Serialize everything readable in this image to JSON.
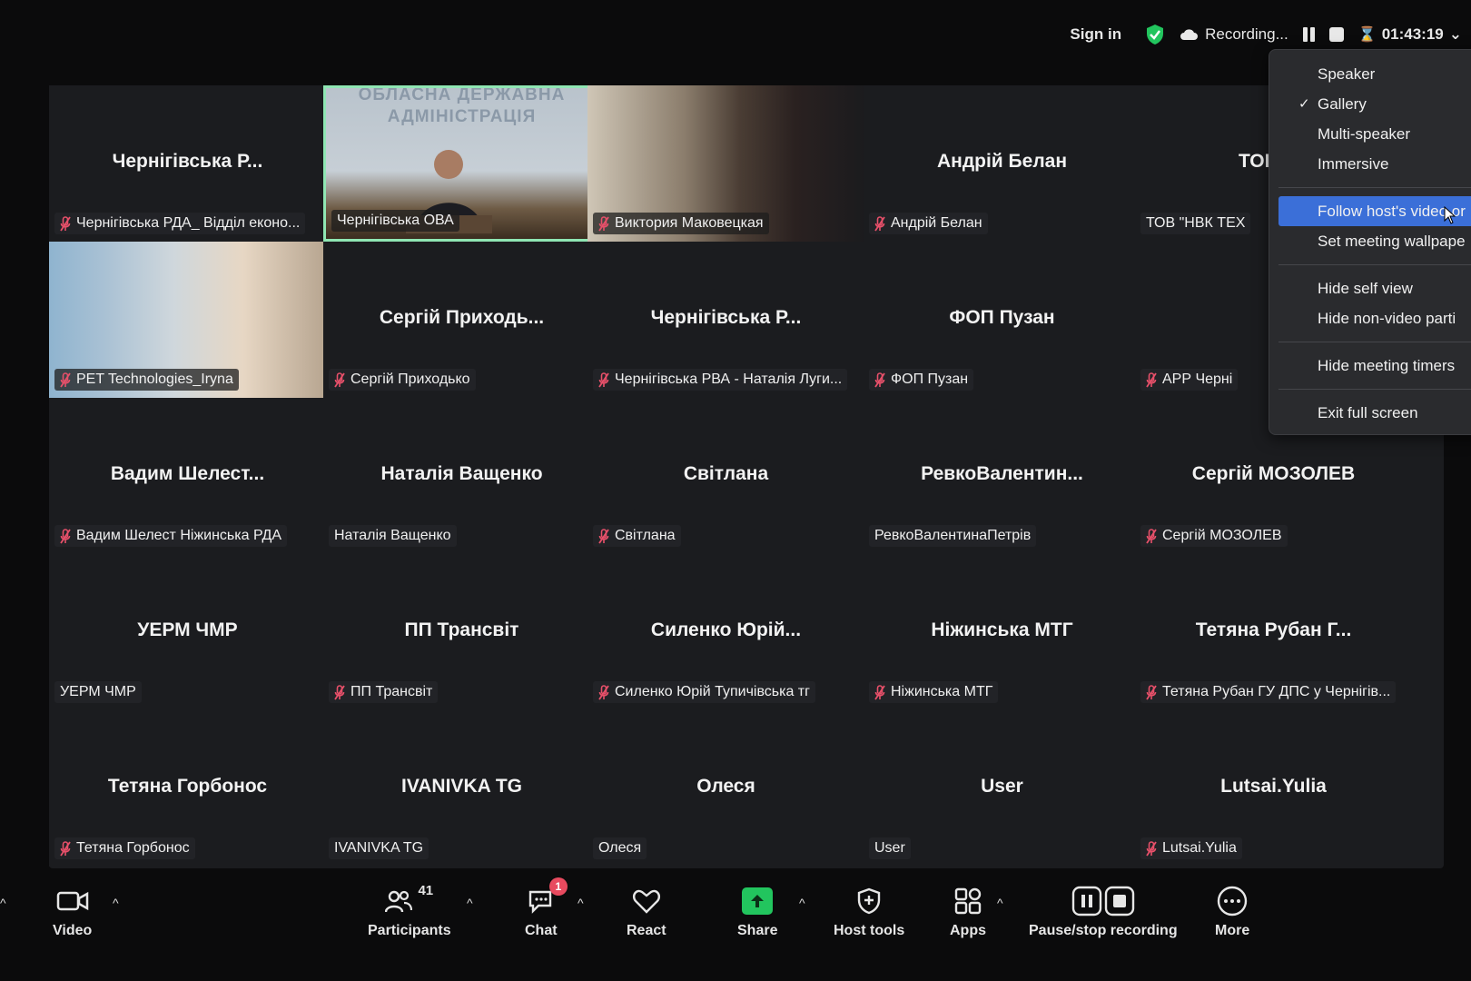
{
  "topbar": {
    "sign_in": "Sign in",
    "recording": "Recording...",
    "timer": "01:43:19"
  },
  "tiles": [
    {
      "display": "Чернігівська Р...",
      "label": "Чернігівська РДА_ Відділ еконо...",
      "muted": true
    },
    {
      "display": "",
      "label": "Чернігівська ОВА",
      "muted": false,
      "video": "room",
      "wall_text": "ОБЛАСНА ДЕРЖАВНА АДМІНІСТРАЦІЯ",
      "active": true
    },
    {
      "display": "",
      "label": "Виктория Маковецкая",
      "muted": true,
      "video": "woman"
    },
    {
      "display": "Андрій Белан",
      "label": "Андрій Белан",
      "muted": true
    },
    {
      "display": "ТОВ \"...",
      "label": "ТОВ \"НВК ТЕХ",
      "muted": false
    },
    {
      "display": "",
      "label": "PET Technologies_Iryna",
      "muted": true,
      "video": "iryna"
    },
    {
      "display": "Сергій Приходь...",
      "label": "Сергій Приходько",
      "muted": true
    },
    {
      "display": "Чернігівська Р...",
      "label": "Чернігівська РВА - Наталія Луги...",
      "muted": true
    },
    {
      "display": "ФОП Пузан",
      "label": "ФОП Пузан",
      "muted": true
    },
    {
      "display": "",
      "label": "АРР Черні",
      "muted": true
    },
    {
      "display": "Вадим Шелест...",
      "label": "Вадим Шелест Ніжинська РДА",
      "muted": true
    },
    {
      "display": "Наталія Ващенко",
      "label": "Наталія Ващенко",
      "muted": false
    },
    {
      "display": "Світлана",
      "label": "Світлана",
      "muted": true
    },
    {
      "display": "РевкоВалентин...",
      "label": "РевкоВалентинаПетрів",
      "muted": false
    },
    {
      "display": "Сергій МОЗОЛЕВ",
      "label": "Сергій МОЗОЛЕВ",
      "muted": true
    },
    {
      "display": "УЕРМ ЧМР",
      "label": "УЕРМ ЧМР",
      "muted": false
    },
    {
      "display": "ПП Трансвіт",
      "label": "ПП Трансвіт",
      "muted": true
    },
    {
      "display": "Силенко Юрій...",
      "label": "Силенко Юрій Тупичівська тг",
      "muted": true
    },
    {
      "display": "Ніжинська МТГ",
      "label": "Ніжинська МТГ",
      "muted": true
    },
    {
      "display": "Тетяна Рубан Г...",
      "label": "Тетяна Рубан ГУ ДПС у Чернігів...",
      "muted": true
    },
    {
      "display": "Тетяна Горбонос",
      "label": "Тетяна Горбонос",
      "muted": true
    },
    {
      "display": "IVANIVKA TG",
      "label": "IVANIVKA TG",
      "muted": false
    },
    {
      "display": "Олеся",
      "label": "Олеся",
      "muted": false
    },
    {
      "display": "User",
      "label": "User",
      "muted": false
    },
    {
      "display": "Lutsai.Yulia",
      "label": "Lutsai.Yulia",
      "muted": true
    }
  ],
  "menu": {
    "speaker": "Speaker",
    "gallery": "Gallery",
    "multi_speaker": "Multi-speaker",
    "immersive": "Immersive",
    "follow_host": "Follow host's video or",
    "wallpaper": "Set meeting wallpape",
    "hide_self": "Hide self view",
    "hide_non_video": "Hide non-video parti",
    "hide_timers": "Hide meeting timers",
    "exit_full": "Exit full screen"
  },
  "toolbar": {
    "video": "Video",
    "participants": "Participants",
    "participants_count": "41",
    "chat": "Chat",
    "chat_badge": "1",
    "react": "React",
    "share": "Share",
    "host_tools": "Host tools",
    "apps": "Apps",
    "pause_stop": "Pause/stop recording",
    "more": "More"
  },
  "colors": {
    "share_green": "#22c55e",
    "active_border": "#8fe6b3",
    "menu_highlight": "#3b6fd8",
    "muted_red": "#e8506a"
  }
}
